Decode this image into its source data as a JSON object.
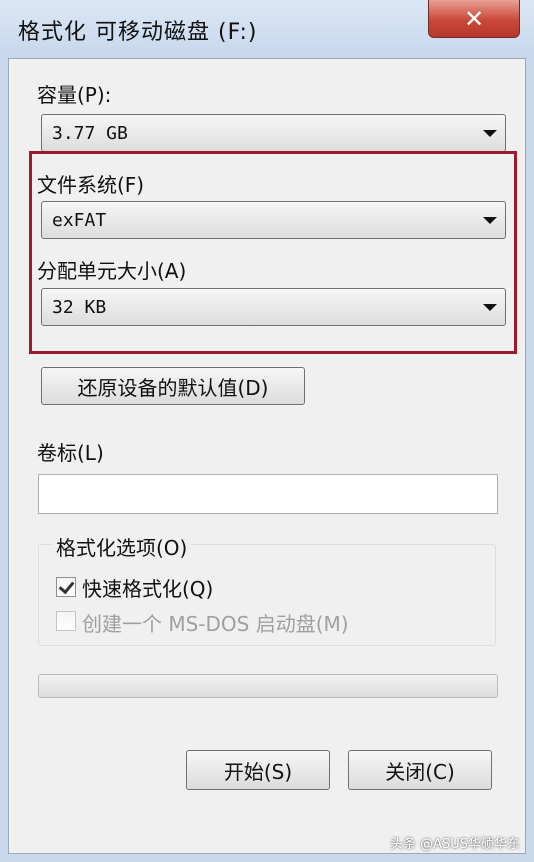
{
  "window": {
    "title": "格式化 可移动磁盘 (F:)",
    "close_glyph": "✕"
  },
  "capacity": {
    "label": "容量(P):",
    "value": "3.77 GB"
  },
  "file_system": {
    "label": "文件系统(F)",
    "value": "exFAT"
  },
  "allocation_unit": {
    "label": "分配单元大小(A)",
    "value": "32 KB"
  },
  "restore_defaults_label": "还原设备的默认值(D)",
  "volume_label": {
    "label": "卷标(L)",
    "value": ""
  },
  "format_options": {
    "title": "格式化选项(O)",
    "quick_format": {
      "label": "快速格式化(Q)",
      "checked": true
    },
    "msdos_boot": {
      "label": "创建一个 MS-DOS 启动盘(M)",
      "checked": false,
      "disabled": true
    }
  },
  "progress": {
    "fraction": 0
  },
  "buttons": {
    "start": "开始(S)",
    "close": "关闭(C)"
  },
  "watermark": "头条 @ASUS华硕华东",
  "colors": {
    "highlight_border": "#9a1b2b",
    "close_button": "#c9483a"
  },
  "icons": {
    "dropdown": "chevron-down-icon",
    "close": "close-icon",
    "check": "checkmark-icon"
  }
}
